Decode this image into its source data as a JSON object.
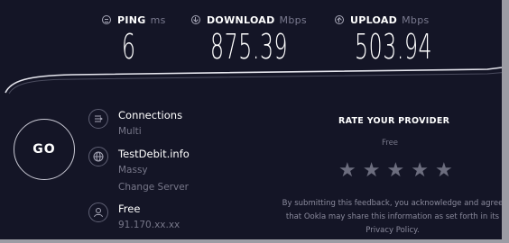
{
  "metrics": {
    "ping": {
      "label": "PING",
      "unit": "ms",
      "value": "6",
      "icon": "ping-icon"
    },
    "download": {
      "label": "DOWNLOAD",
      "unit": "Mbps",
      "value": "875.39",
      "icon": "download-icon"
    },
    "upload": {
      "label": "UPLOAD",
      "unit": "Mbps",
      "value": "503.94",
      "icon": "upload-icon"
    }
  },
  "go_button": {
    "label": "GO"
  },
  "connections": {
    "title": "Connections",
    "value": "Multi",
    "icon": "connections-icon"
  },
  "server": {
    "title": "TestDebit.info",
    "location": "Massy",
    "change_label": "Change Server",
    "icon": "globe-icon"
  },
  "provider": {
    "title": "Free",
    "ip": "91.170.xx.xx",
    "icon": "user-icon"
  },
  "rating": {
    "title": "RATE YOUR PROVIDER",
    "isp": "Free",
    "stars": 5,
    "star_glyph": "★",
    "disclaimer": "By submitting this feedback, you acknowledge and agree that Ookla may share this information as set forth in its Privacy Policy."
  },
  "colors": {
    "background": "#141526",
    "text": "#ffffff",
    "muted": "#777789",
    "star": "#6c6d7e",
    "frame": "#9c9ca4"
  }
}
